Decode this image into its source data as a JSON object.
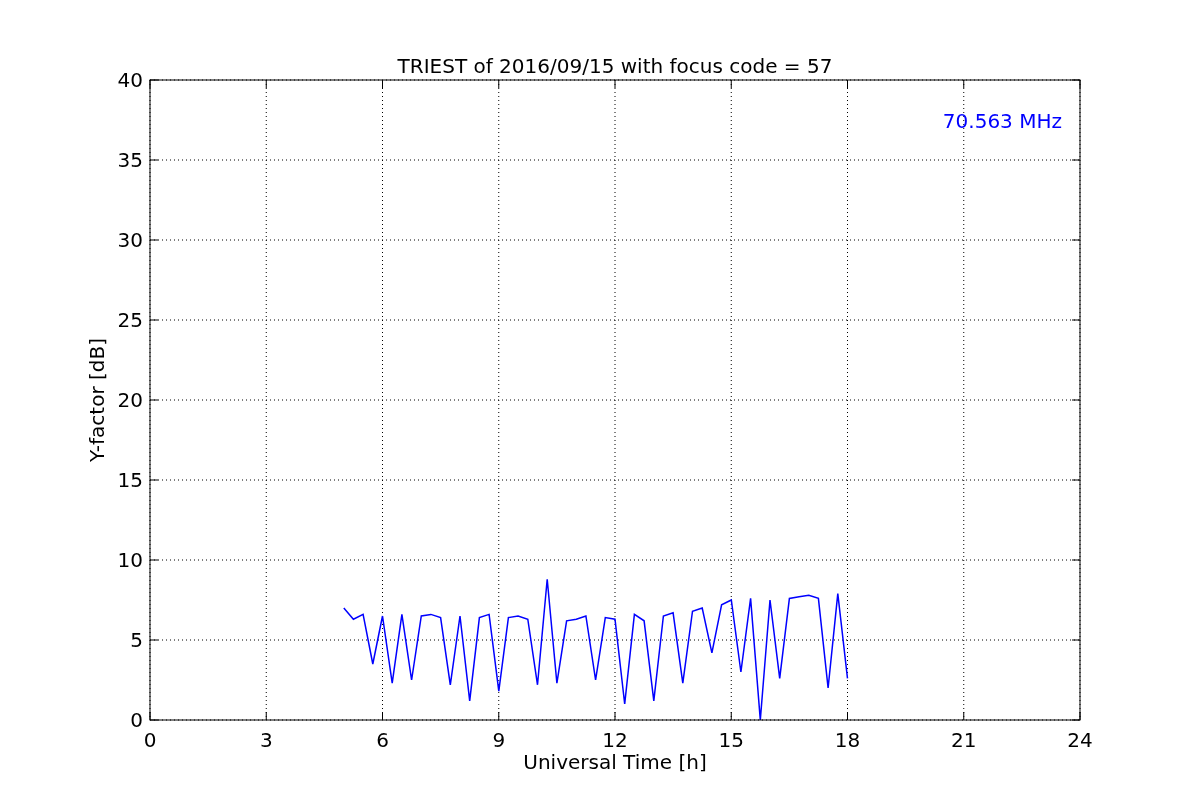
{
  "figure": {
    "chart_data": {
      "type": "line",
      "grid": true,
      "title": "TRIEST of 2016/09/15 with focus code = 57",
      "xlabel": "Universal Time [h]",
      "ylabel": "Y-factor [dB]",
      "xlim": [
        0,
        24
      ],
      "ylim": [
        0,
        40
      ],
      "xticks": [
        0,
        3,
        6,
        9,
        12,
        15,
        18,
        21,
        24
      ],
      "yticks": [
        0,
        5,
        10,
        15,
        20,
        25,
        30,
        35,
        40
      ],
      "x": [
        5,
        5.25,
        5.5,
        5.75,
        6,
        6.25,
        6.5,
        6.75,
        7,
        7.25,
        7.5,
        7.75,
        8,
        8.25,
        8.5,
        8.75,
        9,
        9.25,
        9.5,
        9.75,
        10,
        10.25,
        10.5,
        10.75,
        11,
        11.25,
        11.5,
        11.75,
        12,
        12.25,
        12.5,
        12.75,
        13,
        13.25,
        13.5,
        13.75,
        14,
        14.25,
        14.5,
        14.75,
        15,
        15.25,
        15.5,
        15.75,
        16,
        16.25,
        16.5,
        16.75,
        17,
        17.25,
        17.5,
        17.75,
        18
      ],
      "series": [
        {
          "color": "#0000ff",
          "values": [
            7.0,
            6.3,
            6.6,
            3.5,
            6.5,
            2.3,
            6.6,
            2.5,
            6.5,
            6.6,
            6.4,
            2.2,
            6.5,
            1.2,
            6.4,
            6.6,
            1.8,
            6.4,
            6.5,
            6.3,
            2.2,
            8.8,
            2.3,
            6.2,
            6.3,
            6.5,
            2.5,
            6.4,
            6.3,
            1.0,
            6.6,
            6.2,
            1.2,
            6.5,
            6.7,
            2.3,
            6.8,
            7.0,
            4.2,
            7.2,
            7.5,
            3.0,
            7.6,
            0,
            7.5,
            2.6,
            7.6,
            7.7,
            7.8,
            7.6,
            2.0,
            7.9,
            2.6
          ]
        }
      ],
      "annotations": [
        "70.563 MHz"
      ]
    }
  }
}
